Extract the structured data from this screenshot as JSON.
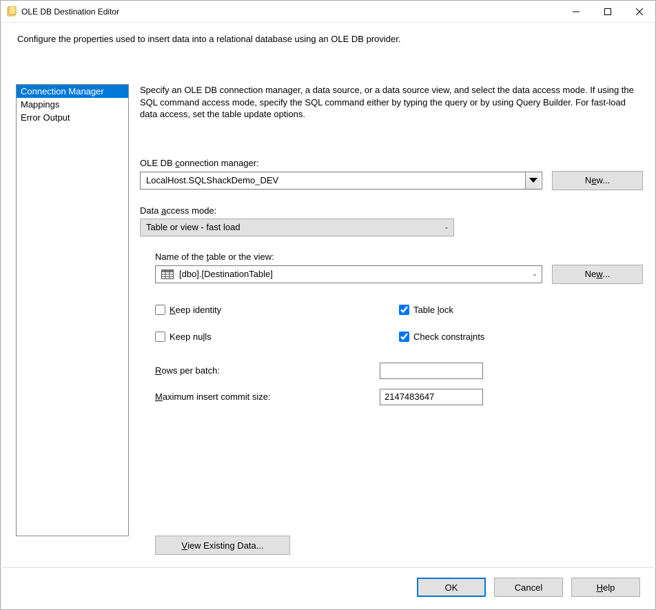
{
  "window": {
    "title": "OLE DB Destination Editor"
  },
  "description": "Configure the properties used to insert data into a relational database using an OLE DB provider.",
  "nav": {
    "items": [
      {
        "label": "Connection Manager",
        "selected": true
      },
      {
        "label": "Mappings",
        "selected": false
      },
      {
        "label": "Error Output",
        "selected": false
      }
    ]
  },
  "main": {
    "instructions": "Specify an OLE DB connection manager, a data source, or a data source view, and select the data access mode. If using the SQL command access mode, specify the SQL command either by typing the query or by using Query Builder. For fast-load data access, set the table update options.",
    "conn_label_pre": "OLE DB ",
    "conn_label_u": "c",
    "conn_label_post": "onnection manager:",
    "conn_value": "LocalHost.SQLShackDemo_DEV",
    "new1_pre": "N",
    "new1_u": "e",
    "new1_post": "w...",
    "access_label_pre": "Data ",
    "access_label_u": "a",
    "access_label_post": "ccess mode:",
    "access_value": "Table or view - fast load",
    "table_label_pre": "Name of the ",
    "table_label_u": "t",
    "table_label_post": "able or the view:",
    "table_value": "[dbo].[DestinationTable]",
    "new2_pre": "Ne",
    "new2_u": "w",
    "new2_post": "...",
    "keep_identity_u": "K",
    "keep_identity_post": "eep identity",
    "table_lock_pre": "Table ",
    "table_lock_u": "l",
    "table_lock_post": "ock",
    "keep_nulls_pre": "Keep nu",
    "keep_nulls_u": "l",
    "keep_nulls_post": "ls",
    "check_constraints_pre": "Check constra",
    "check_constraints_u": "i",
    "check_constraints_post": "nts",
    "rows_u": "R",
    "rows_post": "ows per batch:",
    "rows_value": "",
    "max_u": "M",
    "max_post": "aximum insert commit size:",
    "max_value": "2147483647",
    "view_existing_u": "V",
    "view_existing_post": "iew Existing Data..."
  },
  "footer": {
    "ok": "OK",
    "cancel": "Cancel",
    "help_u": "H",
    "help_post": "elp"
  }
}
